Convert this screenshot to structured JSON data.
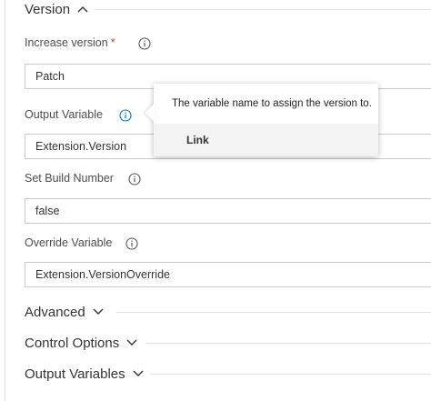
{
  "version_section": {
    "title": "Version",
    "chevron": "chevron-up-icon"
  },
  "increase_version": {
    "label": "Increase version",
    "required_marker": "*",
    "value": "Patch"
  },
  "output_variable": {
    "label": "Output Variable",
    "value": "Extension.Version"
  },
  "set_build_number": {
    "label": "Set Build Number",
    "value": "false"
  },
  "override_variable": {
    "label": "Override Variable",
    "value": "Extension.VersionOverride"
  },
  "callout": {
    "text": "The variable name to assign the version to.",
    "link": "Link"
  },
  "sections": {
    "advanced": "Advanced",
    "control_options": "Control Options",
    "output_variables": "Output Variables"
  },
  "colors": {
    "info_active": "#0078d4",
    "info_default": "#555555",
    "required": "#d13438"
  }
}
